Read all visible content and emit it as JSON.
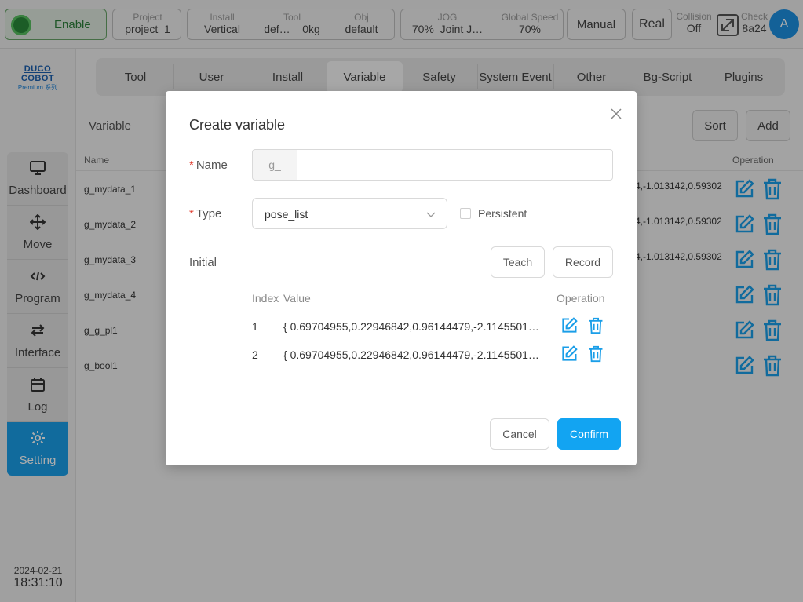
{
  "topbar": {
    "enable_label": "Enable",
    "project": {
      "key": "Project",
      "value": "project_1"
    },
    "install": {
      "key": "Install",
      "value": "Vertical"
    },
    "tool": {
      "key": "Tool",
      "value_a": "def…",
      "value_b": "0kg"
    },
    "obj": {
      "key": "Obj",
      "value": "default"
    },
    "jog": {
      "key": "JOG",
      "value_a": "70%",
      "value_b": "Joint J…"
    },
    "global_speed": {
      "key": "Global Speed",
      "value": "70%"
    },
    "mode_label": "Manual",
    "real_label": "Real",
    "collision": {
      "key": "Collision",
      "value": "Off"
    },
    "check": {
      "key": "Check",
      "value": "8a24"
    },
    "avatar_letter": "A"
  },
  "brand": {
    "line1": "DUCO COBOT",
    "line2": "Premium 系列"
  },
  "nav": [
    {
      "label": "Dashboard",
      "icon": "monitor-icon"
    },
    {
      "label": "Move",
      "icon": "move-icon"
    },
    {
      "label": "Program",
      "icon": "code-icon"
    },
    {
      "label": "Interface",
      "icon": "swap-icon"
    },
    {
      "label": "Log",
      "icon": "calendar-icon"
    },
    {
      "label": "Setting",
      "icon": "gear-icon",
      "active": true
    }
  ],
  "datetime": {
    "date": "2024-02-21",
    "time": "18:31:10"
  },
  "tabs": [
    "Tool",
    "User",
    "Install",
    "Variable",
    "Safety",
    "System Event",
    "Other",
    "Bg-Script",
    "Plugins"
  ],
  "active_tab": "Variable",
  "variables_page": {
    "title": "Variable",
    "sort_label": "Sort",
    "add_label": "Add",
    "col_name": "Name",
    "col_operation": "Operation",
    "rows": [
      {
        "name": "g_mydata_1",
        "value": "4,-1.013142,0.59302"
      },
      {
        "name": "g_mydata_2",
        "value": "4,-1.013142,0.59302"
      },
      {
        "name": "g_mydata_3",
        "value": "4,-1.013142,0.59302"
      },
      {
        "name": "g_mydata_4",
        "value": ""
      },
      {
        "name": "g_g_pl1",
        "value": ""
      },
      {
        "name": "g_bool1",
        "value": ""
      }
    ]
  },
  "modal": {
    "title": "Create variable",
    "name_label": "Name",
    "name_prefix": "g_",
    "name_value": "",
    "type_label": "Type",
    "type_value": "pose_list",
    "persistent_label": "Persistent",
    "initial_label": "Initial",
    "teach_label": "Teach",
    "record_label": "Record",
    "col_index": "Index",
    "col_value": "Value",
    "col_operation": "Operation",
    "rows": [
      {
        "index": "1",
        "value": "{ 0.69704955,0.22946842,0.96144479,-2.1145501…"
      },
      {
        "index": "2",
        "value": "{ 0.69704955,0.22946842,0.96144479,-2.1145501…"
      }
    ],
    "cancel_label": "Cancel",
    "confirm_label": "Confirm"
  },
  "colors": {
    "accent": "#12a4f2",
    "enable_green": "#2d7f3a",
    "required": "#e0392b",
    "nav_active": "#1a9ee8"
  }
}
